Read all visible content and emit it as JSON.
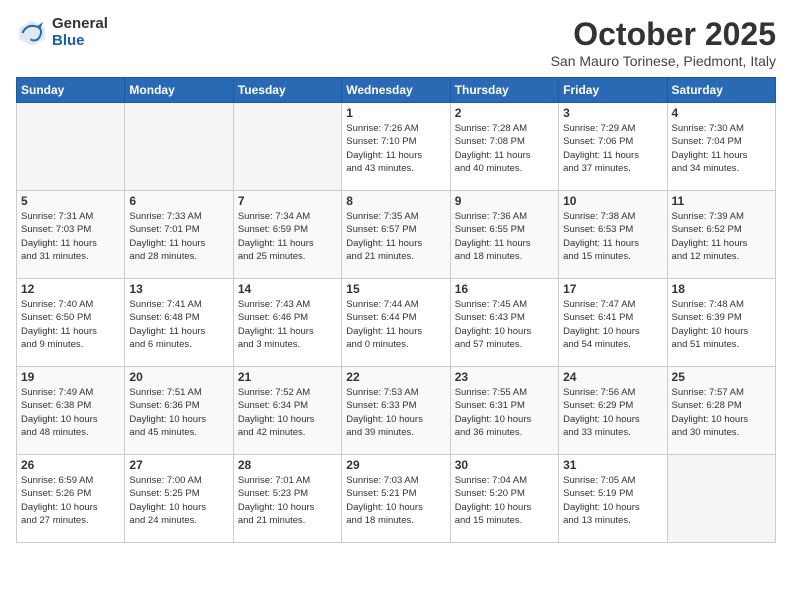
{
  "logo": {
    "general": "General",
    "blue": "Blue"
  },
  "title": "October 2025",
  "location": "San Mauro Torinese, Piedmont, Italy",
  "days_of_week": [
    "Sunday",
    "Monday",
    "Tuesday",
    "Wednesday",
    "Thursday",
    "Friday",
    "Saturday"
  ],
  "weeks": [
    [
      {
        "num": "",
        "info": ""
      },
      {
        "num": "",
        "info": ""
      },
      {
        "num": "",
        "info": ""
      },
      {
        "num": "1",
        "info": "Sunrise: 7:26 AM\nSunset: 7:10 PM\nDaylight: 11 hours\nand 43 minutes."
      },
      {
        "num": "2",
        "info": "Sunrise: 7:28 AM\nSunset: 7:08 PM\nDaylight: 11 hours\nand 40 minutes."
      },
      {
        "num": "3",
        "info": "Sunrise: 7:29 AM\nSunset: 7:06 PM\nDaylight: 11 hours\nand 37 minutes."
      },
      {
        "num": "4",
        "info": "Sunrise: 7:30 AM\nSunset: 7:04 PM\nDaylight: 11 hours\nand 34 minutes."
      }
    ],
    [
      {
        "num": "5",
        "info": "Sunrise: 7:31 AM\nSunset: 7:03 PM\nDaylight: 11 hours\nand 31 minutes."
      },
      {
        "num": "6",
        "info": "Sunrise: 7:33 AM\nSunset: 7:01 PM\nDaylight: 11 hours\nand 28 minutes."
      },
      {
        "num": "7",
        "info": "Sunrise: 7:34 AM\nSunset: 6:59 PM\nDaylight: 11 hours\nand 25 minutes."
      },
      {
        "num": "8",
        "info": "Sunrise: 7:35 AM\nSunset: 6:57 PM\nDaylight: 11 hours\nand 21 minutes."
      },
      {
        "num": "9",
        "info": "Sunrise: 7:36 AM\nSunset: 6:55 PM\nDaylight: 11 hours\nand 18 minutes."
      },
      {
        "num": "10",
        "info": "Sunrise: 7:38 AM\nSunset: 6:53 PM\nDaylight: 11 hours\nand 15 minutes."
      },
      {
        "num": "11",
        "info": "Sunrise: 7:39 AM\nSunset: 6:52 PM\nDaylight: 11 hours\nand 12 minutes."
      }
    ],
    [
      {
        "num": "12",
        "info": "Sunrise: 7:40 AM\nSunset: 6:50 PM\nDaylight: 11 hours\nand 9 minutes."
      },
      {
        "num": "13",
        "info": "Sunrise: 7:41 AM\nSunset: 6:48 PM\nDaylight: 11 hours\nand 6 minutes."
      },
      {
        "num": "14",
        "info": "Sunrise: 7:43 AM\nSunset: 6:46 PM\nDaylight: 11 hours\nand 3 minutes."
      },
      {
        "num": "15",
        "info": "Sunrise: 7:44 AM\nSunset: 6:44 PM\nDaylight: 11 hours\nand 0 minutes."
      },
      {
        "num": "16",
        "info": "Sunrise: 7:45 AM\nSunset: 6:43 PM\nDaylight: 10 hours\nand 57 minutes."
      },
      {
        "num": "17",
        "info": "Sunrise: 7:47 AM\nSunset: 6:41 PM\nDaylight: 10 hours\nand 54 minutes."
      },
      {
        "num": "18",
        "info": "Sunrise: 7:48 AM\nSunset: 6:39 PM\nDaylight: 10 hours\nand 51 minutes."
      }
    ],
    [
      {
        "num": "19",
        "info": "Sunrise: 7:49 AM\nSunset: 6:38 PM\nDaylight: 10 hours\nand 48 minutes."
      },
      {
        "num": "20",
        "info": "Sunrise: 7:51 AM\nSunset: 6:36 PM\nDaylight: 10 hours\nand 45 minutes."
      },
      {
        "num": "21",
        "info": "Sunrise: 7:52 AM\nSunset: 6:34 PM\nDaylight: 10 hours\nand 42 minutes."
      },
      {
        "num": "22",
        "info": "Sunrise: 7:53 AM\nSunset: 6:33 PM\nDaylight: 10 hours\nand 39 minutes."
      },
      {
        "num": "23",
        "info": "Sunrise: 7:55 AM\nSunset: 6:31 PM\nDaylight: 10 hours\nand 36 minutes."
      },
      {
        "num": "24",
        "info": "Sunrise: 7:56 AM\nSunset: 6:29 PM\nDaylight: 10 hours\nand 33 minutes."
      },
      {
        "num": "25",
        "info": "Sunrise: 7:57 AM\nSunset: 6:28 PM\nDaylight: 10 hours\nand 30 minutes."
      }
    ],
    [
      {
        "num": "26",
        "info": "Sunrise: 6:59 AM\nSunset: 5:26 PM\nDaylight: 10 hours\nand 27 minutes."
      },
      {
        "num": "27",
        "info": "Sunrise: 7:00 AM\nSunset: 5:25 PM\nDaylight: 10 hours\nand 24 minutes."
      },
      {
        "num": "28",
        "info": "Sunrise: 7:01 AM\nSunset: 5:23 PM\nDaylight: 10 hours\nand 21 minutes."
      },
      {
        "num": "29",
        "info": "Sunrise: 7:03 AM\nSunset: 5:21 PM\nDaylight: 10 hours\nand 18 minutes."
      },
      {
        "num": "30",
        "info": "Sunrise: 7:04 AM\nSunset: 5:20 PM\nDaylight: 10 hours\nand 15 minutes."
      },
      {
        "num": "31",
        "info": "Sunrise: 7:05 AM\nSunset: 5:19 PM\nDaylight: 10 hours\nand 13 minutes."
      },
      {
        "num": "",
        "info": ""
      }
    ]
  ]
}
